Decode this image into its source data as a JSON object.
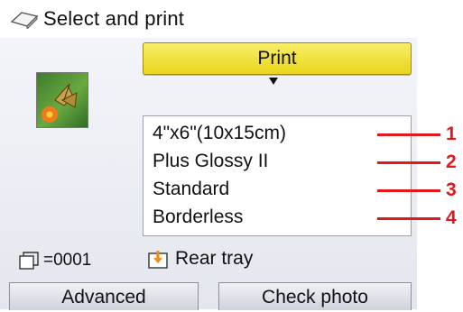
{
  "header": {
    "title": "Select and print",
    "icon": "paper-icon"
  },
  "print_button": {
    "label": "Print"
  },
  "thumbnail": {
    "icon": "photo-thumbnail"
  },
  "settings": [
    {
      "label": "4\"x6\"(10x15cm)",
      "callout": "1"
    },
    {
      "label": "Plus Glossy II",
      "callout": "2"
    },
    {
      "label": "Standard",
      "callout": "3"
    },
    {
      "label": "Borderless",
      "callout": "4"
    }
  ],
  "status": {
    "copies_text": "=0001",
    "copies_icon": "copies-icon",
    "tray_text": "Rear tray",
    "tray_icon": "rear-tray-icon"
  },
  "soft_buttons": {
    "left": "Advanced",
    "right": "Check photo"
  },
  "colors": {
    "print_button": "#e9d518",
    "callout": "#e0191d"
  }
}
